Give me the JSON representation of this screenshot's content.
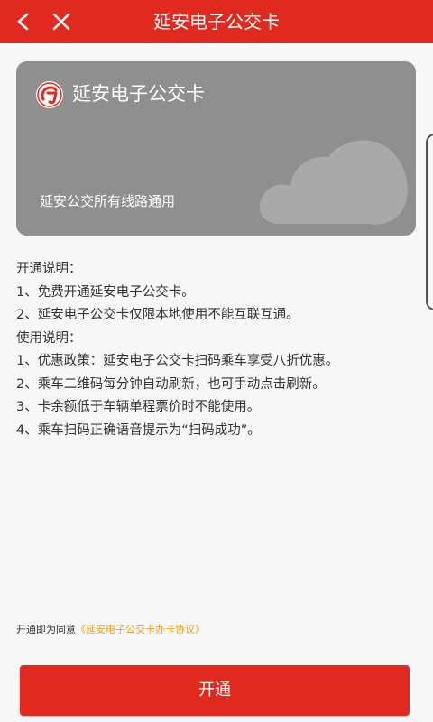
{
  "header": {
    "title": "延安电子公交卡"
  },
  "card": {
    "title": "延安电子公交卡",
    "subtitle": "延安公交所有线路通用",
    "logo_text": "GJ"
  },
  "description": {
    "lines": [
      "开通说明：",
      "1、免费开通延安电子公交卡。",
      "2、延安电子公交卡仅限本地使用不能互联互通。",
      "使用说明：",
      "1、优惠政策：延安电子公交卡扫码乘车享受八折优惠。",
      "2、乘车二维码每分钟自动刷新，也可手动点击刷新。",
      "3、卡余额低于车辆单程票价时不能使用。",
      "4、乘车扫码正确语音提示为“扫码成功”。"
    ]
  },
  "agreement": {
    "prefix": "开通即为同意",
    "link_text": "《延安电子公交卡办卡协议》"
  },
  "actions": {
    "open_label": "开通"
  },
  "colors": {
    "brand_red": "#e02a1f",
    "card_gray": "#8f8f8f",
    "link_orange": "#e6a21e"
  }
}
